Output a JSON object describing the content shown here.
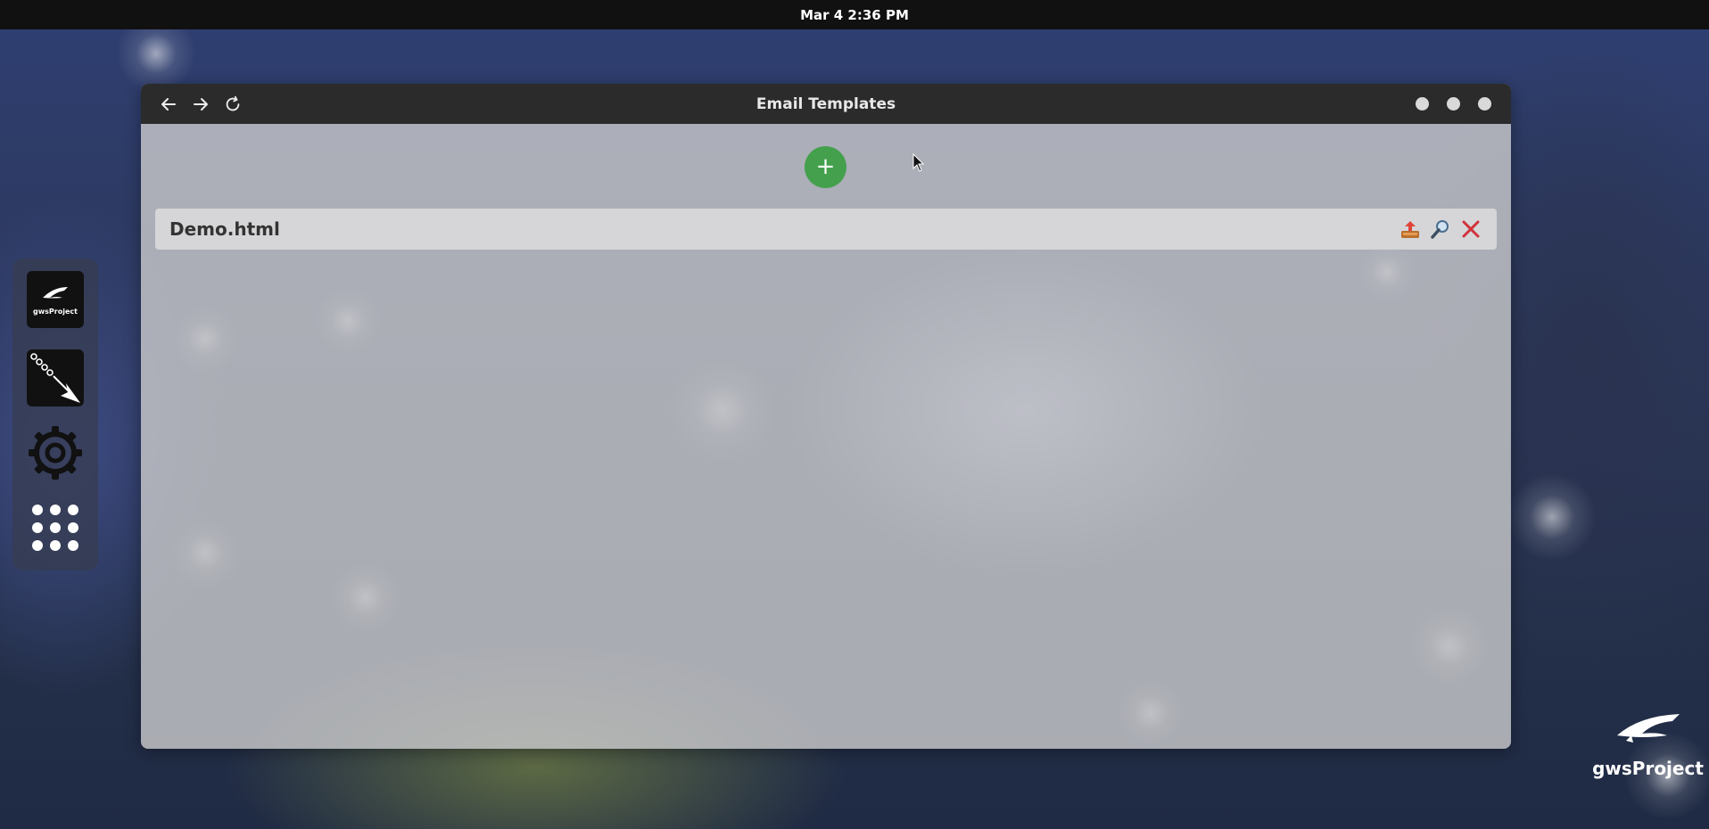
{
  "system": {
    "clock": "Mar 4  2:36 PM"
  },
  "window": {
    "title": "Email Templates",
    "nav": {
      "back_icon": "arrow-left-icon",
      "forward_icon": "arrow-right-icon",
      "reload_icon": "reload-icon"
    },
    "controls": [
      "minimize",
      "maximize",
      "close"
    ]
  },
  "main": {
    "add_button_label": "+",
    "templates": [
      {
        "name": "Demo.html",
        "actions": [
          "upload-icon",
          "search-icon",
          "delete-icon"
        ]
      }
    ]
  },
  "dock": {
    "items": [
      {
        "name": "gwsProject",
        "label": "gwsProject",
        "icon": "gwsproject-logo-icon"
      },
      {
        "name": "chain-arrow",
        "icon": "chain-arrow-icon"
      },
      {
        "name": "settings",
        "icon": "gear-icon"
      },
      {
        "name": "apps",
        "icon": "grid-dots-icon"
      }
    ]
  },
  "desktop": {
    "brand_label": "gwsProject"
  },
  "colors": {
    "topbar": "#111111",
    "titlebar": "#2b2b2b",
    "add_button": "#44a04d",
    "delete": "#d0333b",
    "upload": "#e05a3a"
  }
}
